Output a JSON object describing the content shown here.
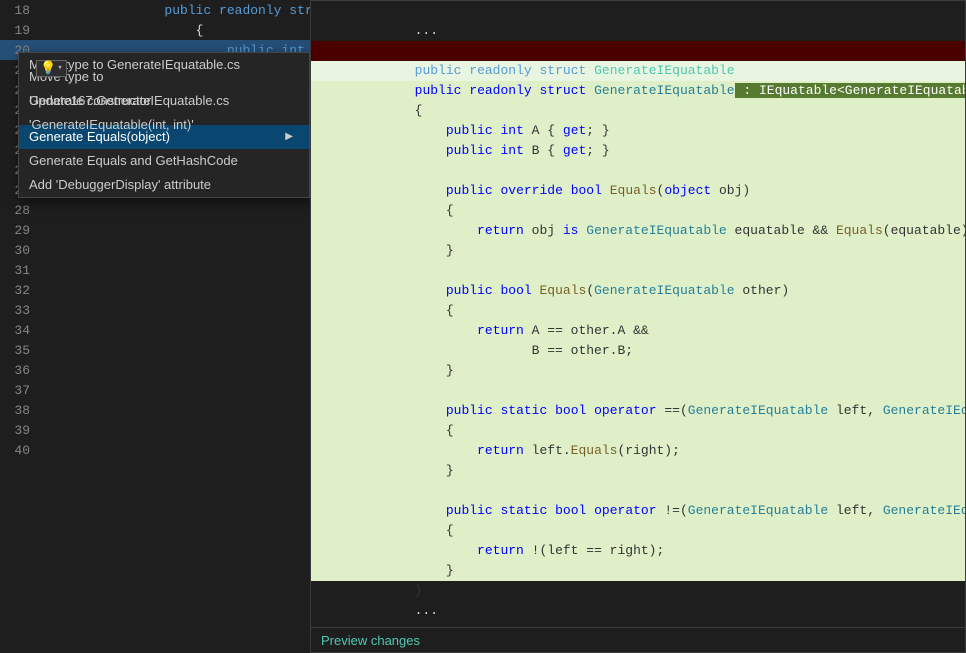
{
  "editor": {
    "lines": [
      {
        "num": "18",
        "code": "    public readonly struct GenerateIEquatable",
        "type": "normal"
      },
      {
        "num": "19",
        "code": "    {",
        "type": "normal"
      },
      {
        "num": "20",
        "code": "        public int A { get; }",
        "type": "highlighted",
        "highlight_start": 15,
        "highlight_end": 28
      },
      {
        "num": "21",
        "code": "",
        "type": "normal"
      },
      {
        "num": "22",
        "code": "",
        "type": "normal"
      },
      {
        "num": "23",
        "code": "",
        "type": "normal"
      },
      {
        "num": "24",
        "code": "",
        "type": "normal"
      },
      {
        "num": "25",
        "code": "",
        "type": "normal"
      },
      {
        "num": "26",
        "code": "",
        "type": "normal"
      },
      {
        "num": "27",
        "code": "",
        "type": "normal"
      },
      {
        "num": "28",
        "code": "",
        "type": "normal"
      },
      {
        "num": "29",
        "code": "",
        "type": "normal"
      },
      {
        "num": "30",
        "code": "",
        "type": "normal"
      },
      {
        "num": "31",
        "code": "",
        "type": "normal"
      },
      {
        "num": "32",
        "code": "",
        "type": "normal"
      },
      {
        "num": "33",
        "code": "",
        "type": "normal"
      },
      {
        "num": "34",
        "code": "",
        "type": "normal"
      },
      {
        "num": "35",
        "code": "",
        "type": "normal"
      },
      {
        "num": "36",
        "code": "",
        "type": "normal"
      },
      {
        "num": "37",
        "code": "",
        "type": "normal"
      },
      {
        "num": "38",
        "code": "",
        "type": "normal"
      },
      {
        "num": "39",
        "code": "",
        "type": "normal"
      },
      {
        "num": "40",
        "code": "",
        "type": "normal"
      }
    ]
  },
  "context_menu": {
    "items": [
      {
        "label": "Move type to GenerateIEquatable.cs",
        "has_arrow": false,
        "active": false
      },
      {
        "label": "Move type to Update167.GenerateIEquatable.cs",
        "has_arrow": false,
        "active": false
      },
      {
        "label": "Generate constructor 'GenerateIEquatable(int, int)'",
        "has_arrow": false,
        "active": false
      },
      {
        "label": "Generate Equals(object)",
        "has_arrow": true,
        "active": true
      },
      {
        "label": "Generate Equals and GetHashCode",
        "has_arrow": false,
        "active": false
      },
      {
        "label": "Add 'DebuggerDisplay' attribute",
        "has_arrow": false,
        "active": false
      }
    ]
  },
  "preview": {
    "title": "Preview changes",
    "lines": [
      {
        "text": "    ...",
        "type": "normal"
      },
      {
        "text": "",
        "type": "normal"
      },
      {
        "text": "    public readonly struct GenerateIEquatable",
        "type": "deleted"
      },
      {
        "text": "    public readonly struct GenerateIEquatable",
        "type": "added",
        "inline_added": " : IEquatable<GenerateIEquatable>"
      },
      {
        "text": "    {",
        "type": "green"
      },
      {
        "text": "        public int A { get; }",
        "type": "green"
      },
      {
        "text": "        public int B { get; }",
        "type": "green"
      },
      {
        "text": "",
        "type": "green"
      },
      {
        "text": "        public override bool Equals(object obj)",
        "type": "green"
      },
      {
        "text": "        {",
        "type": "green"
      },
      {
        "text": "            return obj is GenerateIEquatable equatable && Equals(equatable);",
        "type": "green"
      },
      {
        "text": "        }",
        "type": "green"
      },
      {
        "text": "",
        "type": "green"
      },
      {
        "text": "        public bool Equals(GenerateIEquatable other)",
        "type": "green"
      },
      {
        "text": "        {",
        "type": "green"
      },
      {
        "text": "            return A == other.A &&",
        "type": "green"
      },
      {
        "text": "                   B == other.B;",
        "type": "green"
      },
      {
        "text": "        }",
        "type": "green"
      },
      {
        "text": "",
        "type": "green"
      },
      {
        "text": "        public static bool operator ==(GenerateIEquatable left, GenerateIEquatable right)",
        "type": "green"
      },
      {
        "text": "        {",
        "type": "green"
      },
      {
        "text": "            return left.Equals(right);",
        "type": "green"
      },
      {
        "text": "        }",
        "type": "green"
      },
      {
        "text": "",
        "type": "green"
      },
      {
        "text": "        public static bool operator !=(GenerateIEquatable left, GenerateIEquatable right)",
        "type": "green"
      },
      {
        "text": "        {",
        "type": "green"
      },
      {
        "text": "            return !(left == right);",
        "type": "green"
      },
      {
        "text": "        }",
        "type": "green"
      },
      {
        "text": "    }",
        "type": "green"
      },
      {
        "text": "    ...",
        "type": "normal"
      }
    ]
  },
  "lightbulb": {
    "symbol": "💡",
    "arrow": "▾"
  }
}
